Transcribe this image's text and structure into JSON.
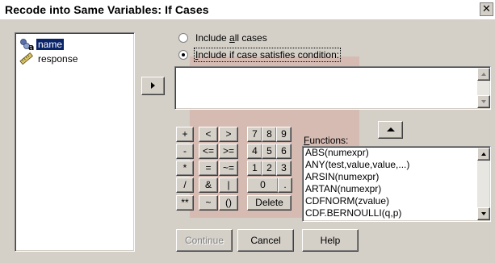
{
  "window": {
    "title": "Recode into Same Variables: If Cases"
  },
  "variables": [
    {
      "label": "name",
      "icon": "string-variable-icon",
      "selected": true
    },
    {
      "label": "response",
      "icon": "scale-variable-icon",
      "selected": false
    }
  ],
  "options": {
    "include_all_pre": "Include ",
    "include_all_u": "a",
    "include_all_post": "ll cases",
    "include_if_pre": "",
    "include_if_u": "I",
    "include_if_post": "nclude if case satisfies condition:",
    "selected": "include_if"
  },
  "condition": {
    "value": ""
  },
  "keypad": {
    "rows": [
      [
        "+",
        "<",
        ">",
        "7",
        "8",
        "9"
      ],
      [
        "-",
        "<=",
        ">=",
        "4",
        "5",
        "6"
      ],
      [
        "*",
        "=",
        "~=",
        "1",
        "2",
        "3"
      ],
      [
        "/",
        "&",
        "|",
        "0",
        "."
      ],
      [
        "**",
        "~",
        "()",
        "Delete"
      ]
    ]
  },
  "functions": {
    "label_u": "F",
    "label_rest": "unctions:",
    "items": [
      "ABS(numexpr)",
      "ANY(test,value,value,...)",
      "ARSIN(numexpr)",
      "ARTAN(numexpr)",
      "CDFNORM(zvalue)",
      "CDF.BERNOULLI(q,p)"
    ]
  },
  "buttons": {
    "continue": "Continue",
    "cancel": "Cancel",
    "help": "Help"
  },
  "colors": {
    "dialog_bg": "#d4d0c8",
    "selection": "#0a246a",
    "watermark": "#e9302a"
  }
}
